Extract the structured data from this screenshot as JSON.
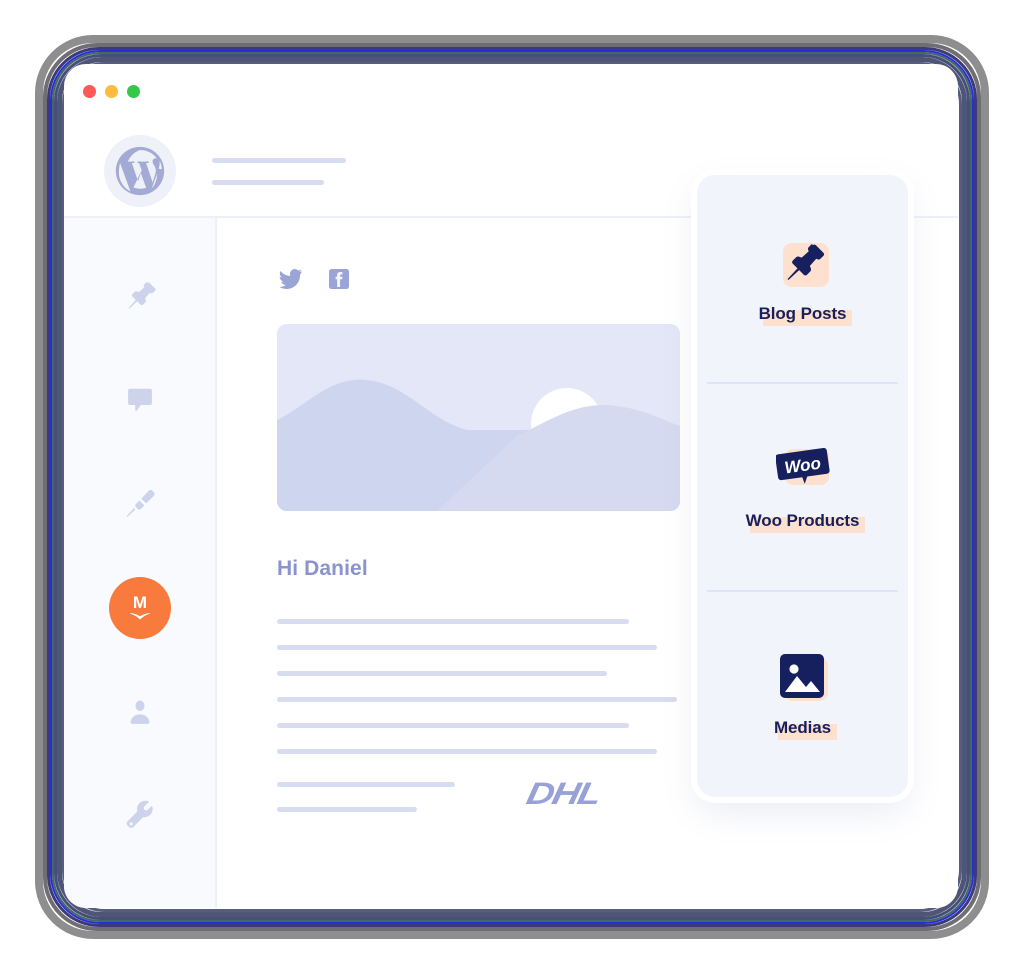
{
  "window": {
    "traffic_lights": [
      {
        "name": "close",
        "color": "#fc5a56"
      },
      {
        "name": "minimize",
        "color": "#fdbc40"
      },
      {
        "name": "maximize",
        "color": "#33c848"
      }
    ],
    "brand_logo": "wordpress-logo"
  },
  "sidebar": {
    "items": [
      {
        "icon": "pin-icon",
        "name": "sidebar-item-posts"
      },
      {
        "icon": "comment-icon",
        "name": "sidebar-item-comments"
      },
      {
        "icon": "paintbrush-icon",
        "name": "sidebar-item-appearance"
      },
      {
        "icon": "mailpoet-icon",
        "name": "sidebar-item-mailpoet",
        "label": "M",
        "active": true,
        "color": "#f97a3d"
      },
      {
        "icon": "user-icon",
        "name": "sidebar-item-users"
      },
      {
        "icon": "wrench-icon",
        "name": "sidebar-item-tools"
      }
    ]
  },
  "editor": {
    "social": [
      {
        "icon": "twitter-icon",
        "name": "social-twitter"
      },
      {
        "icon": "facebook-icon",
        "name": "social-facebook"
      }
    ],
    "hero_image": "landscape-placeholder-image",
    "greeting": "Hi Daniel",
    "body_line_widths": [
      352,
      380,
      330,
      400,
      352,
      380
    ],
    "footer_line_widths": [
      178,
      140
    ],
    "brand_logo_text": "DHL"
  },
  "panel": {
    "accent_color": "#fde0cd",
    "icon_color": "#17205e",
    "cards": [
      {
        "label": "Blog Posts",
        "icon": "pin-icon",
        "name": "panel-card-blog-posts"
      },
      {
        "label": "Woo Products",
        "icon": "woo-icon",
        "name": "panel-card-woo-products"
      },
      {
        "label": "Medias",
        "icon": "image-icon",
        "name": "panel-card-medias"
      }
    ]
  }
}
